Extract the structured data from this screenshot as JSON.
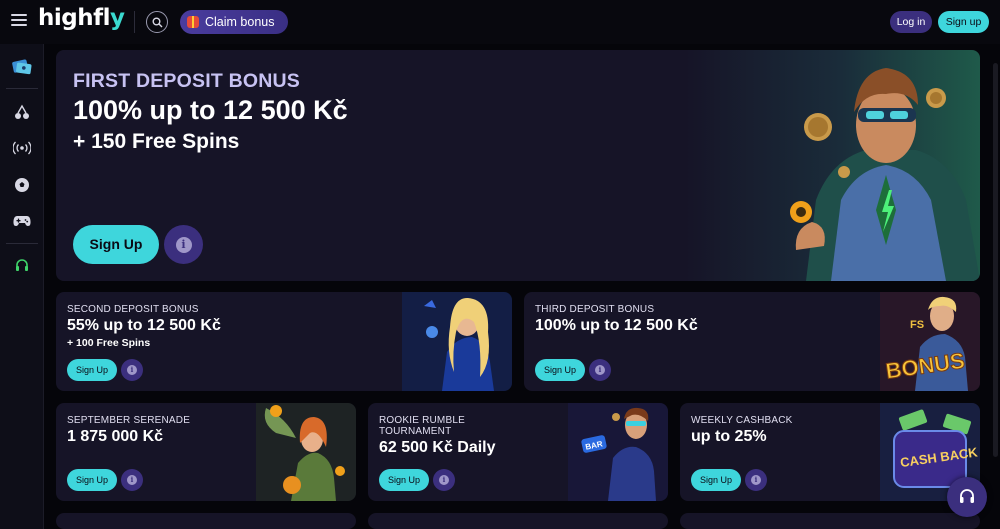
{
  "header": {
    "logo_main": "highfl",
    "logo_accent": "y",
    "claim_bonus": "Claim bonus",
    "login": "Log in",
    "signup": "Sign up"
  },
  "sidebar": {
    "icons": [
      "promotions-icon",
      "cherries-icon",
      "live-icon",
      "football-icon",
      "gamepad-icon",
      "support-icon"
    ]
  },
  "hero": {
    "kicker": "FIRST DEPOSIT BONUS",
    "title": "100% up to 12 500 Kč",
    "subtitle": "+ 150 Free Spins",
    "signup": "Sign Up"
  },
  "cards": [
    {
      "kicker": "SECOND DEPOSIT BONUS",
      "title": "55% up to 12 500 Kč",
      "subtitle": "+ 100 Free Spins",
      "signup": "Sign Up"
    },
    {
      "kicker": "THIRD DEPOSIT BONUS",
      "title": "100% up to 12 500 Kč",
      "signup": "Sign Up",
      "art_text": "BONUS"
    },
    {
      "kicker": "SEPTEMBER SERENADE",
      "title": "1 875 000 Kč",
      "signup": "Sign Up"
    },
    {
      "kicker": "ROOKIE RUMBLE TOURNAMENT",
      "title": "62 500 Kč Daily",
      "signup": "Sign Up",
      "art_text": "BAR"
    },
    {
      "kicker": "WEEKLY CASHBACK",
      "title": "up to 25%",
      "signup": "Sign Up",
      "art_text": "CASH BACK"
    }
  ],
  "colors": {
    "accent": "#3ed6dc",
    "purple": "#3b2f7e",
    "card_bg": "#161427",
    "page_bg": "#05050a"
  }
}
